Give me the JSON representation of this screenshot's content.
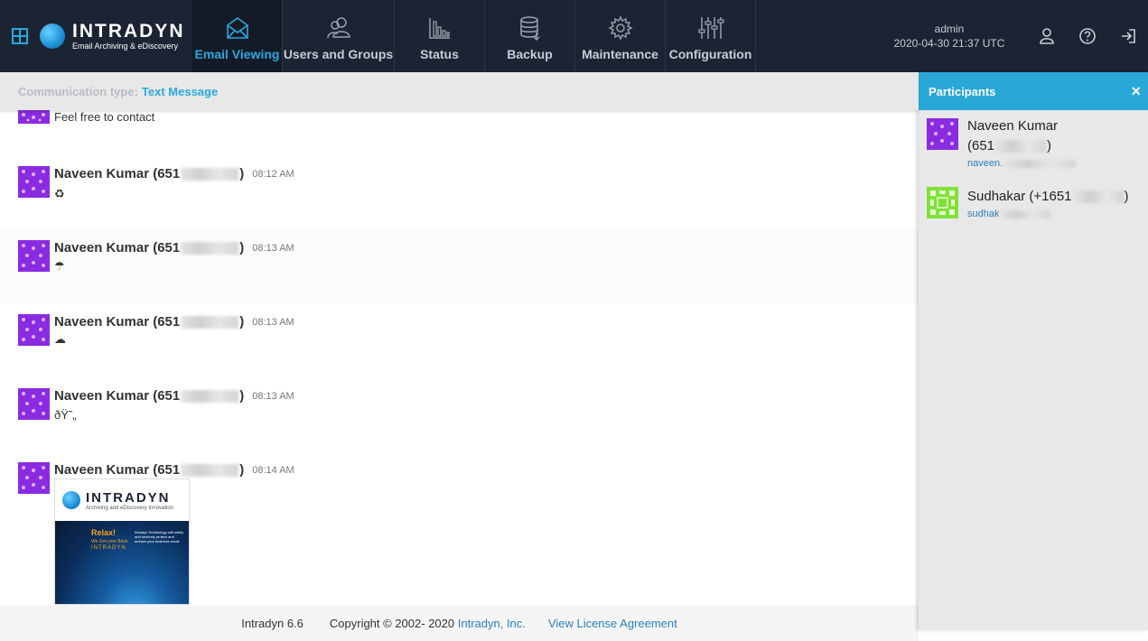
{
  "app": {
    "logo_name": "INTRADYN",
    "logo_tagline": "Email Archiving & eDiscovery"
  },
  "nav": {
    "tabs": [
      {
        "label": "Email Viewing",
        "icon": "envelope-icon",
        "active": true
      },
      {
        "label": "Users and Groups",
        "icon": "users-icon",
        "active": false
      },
      {
        "label": "Status",
        "icon": "bar-chart-icon",
        "active": false
      },
      {
        "label": "Backup",
        "icon": "database-icon",
        "active": false
      },
      {
        "label": "Maintenance",
        "icon": "gear-icon",
        "active": false
      },
      {
        "label": "Configuration",
        "icon": "sliders-icon",
        "active": false
      }
    ]
  },
  "user": {
    "name": "admin",
    "datetime": "2020-04-30 21:37 UTC"
  },
  "toolbar": {
    "icons": [
      "user-icon",
      "help-icon",
      "logout-icon"
    ]
  },
  "comm": {
    "label": "Communication type:",
    "value": "Text Message"
  },
  "messages": [
    {
      "sender": "",
      "time": "",
      "body": "Feel free to contact"
    },
    {
      "sender": "Naveen Kumar (651",
      "time": "08:12 AM",
      "body": "♻"
    },
    {
      "sender": "Naveen Kumar (651",
      "time": "08:13 AM",
      "body": "☂"
    },
    {
      "sender": "Naveen Kumar (651",
      "time": "08:13 AM",
      "body": "☁"
    },
    {
      "sender": "Naveen Kumar (651",
      "time": "08:13 AM",
      "body": "ðŸ˜„"
    },
    {
      "sender": "Naveen Kumar (651",
      "time": "08:14 AM",
      "body": ""
    }
  ],
  "attachment": {
    "brand": "INTRADYN",
    "tagline": "Archiving and eDiscovery Innovation",
    "headline": "Relax!",
    "line1": "We Got your Back",
    "line2": "INTRADYN",
    "side_text": "Intradyn Technology will safely and securely protect and archive your business email"
  },
  "footer": {
    "version": "Intradyn 6.6",
    "copyright": "Copyright © 2002- 2020",
    "company_link": "Intradyn, Inc.",
    "license_link": "View License Agreement"
  },
  "participants_panel": {
    "title": "Participants",
    "close": "×",
    "participants": [
      {
        "name_line1": "Naveen Kumar",
        "name_line2": "(651",
        "email": "naveen."
      },
      {
        "name_line1": "Sudhakar (+1651",
        "name_line2": "",
        "email": "sudhak"
      }
    ]
  },
  "colors": {
    "topbar": "#1b2433",
    "accent": "#29a8e0",
    "avatar_purple": "#8a2be2",
    "avatar_green": "#7fe23a",
    "link": "#2a7fc1"
  }
}
